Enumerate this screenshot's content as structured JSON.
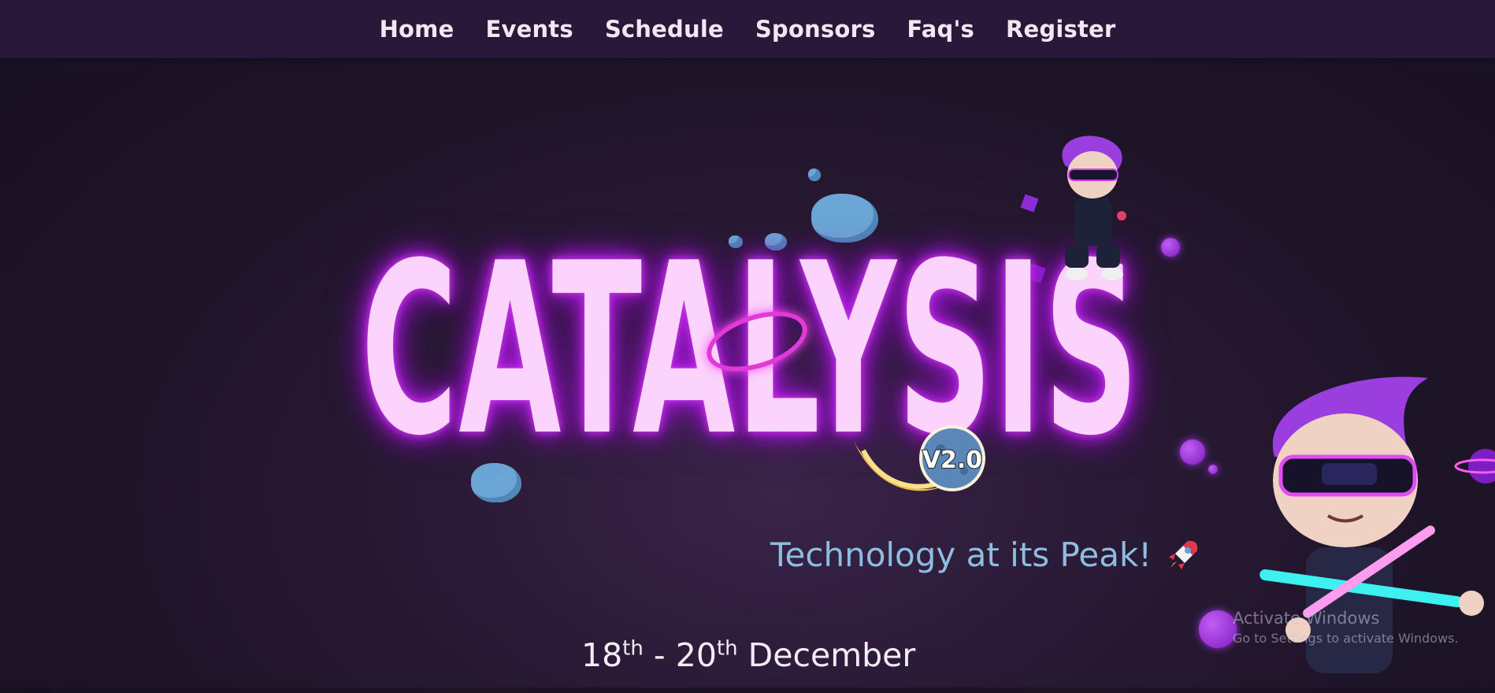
{
  "nav": {
    "items": [
      {
        "label": "Home"
      },
      {
        "label": "Events"
      },
      {
        "label": "Schedule"
      },
      {
        "label": "Sponsors"
      },
      {
        "label": "Faq's"
      },
      {
        "label": "Register"
      }
    ]
  },
  "hero": {
    "logo_text": "CATALYSIS",
    "version_badge": "V2.0",
    "tagline": "Technology at its Peak!",
    "tagline_icon": "rocket-icon",
    "dates": {
      "start_day": "18",
      "start_suffix": "th",
      "separator": "-",
      "end_day": "20",
      "end_suffix": "th",
      "month": "December"
    }
  },
  "overlay": {
    "activate_title": "Activate Windows",
    "activate_subtitle": "Go to Settings to activate Windows."
  },
  "colors": {
    "nav_bg": "#2a1838",
    "logo_fill": "#fbd3fb",
    "logo_glow": "#b41ee0",
    "tagline": "#8fbde0",
    "accent_purple": "#9a36e0"
  }
}
